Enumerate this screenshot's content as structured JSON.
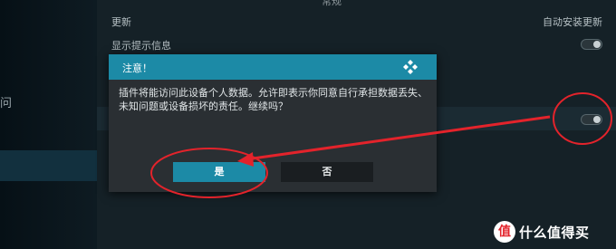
{
  "background": {
    "top_label": "常规",
    "left_partial_char": "问",
    "row1": {
      "left": "更新",
      "right": "自动安装更新"
    },
    "row2": {
      "left": "显示提示信息"
    }
  },
  "dialog": {
    "title": "注意！",
    "message": "插件将能访问此设备个人数据。允许即表示你同意自行承担数据丢失、未知问题或设备损坏的责任。继续吗？",
    "yes_label": "是",
    "no_label": "否"
  },
  "watermark": {
    "icon_char": "值",
    "text": "什么值得买"
  },
  "colors": {
    "accent": "#1c8aa6",
    "annotation_red": "#e3232b"
  }
}
